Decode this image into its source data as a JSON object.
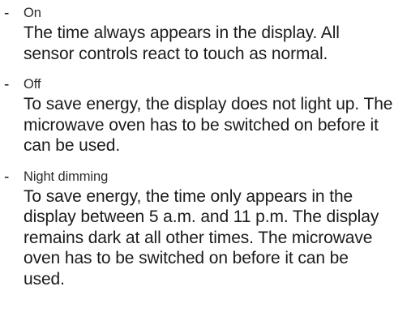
{
  "options": [
    {
      "bullet": "-",
      "label": "On",
      "description": "The time always appears in the display. All sensor controls react to touch as normal."
    },
    {
      "bullet": "-",
      "label": "Off",
      "description": "To save energy, the display does not light up. The microwave oven has to be switched on before it can be used."
    },
    {
      "bullet": "-",
      "label": "Night dimming",
      "description": "To save energy, the time only appears in the display between 5 a.m. and 11 p.m. The display remains dark at all other times. The microwave oven has to be switched on before it can be used."
    }
  ]
}
